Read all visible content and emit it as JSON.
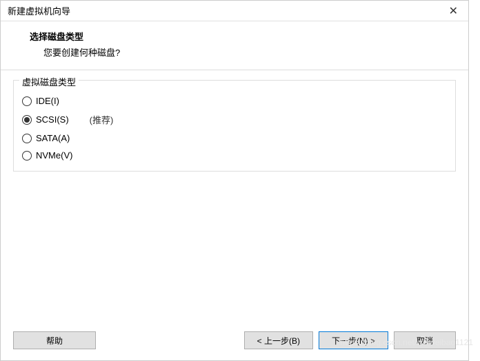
{
  "titlebar": {
    "title": "新建虚拟机向导"
  },
  "header": {
    "title": "选择磁盘类型",
    "subtitle": "您要创建何种磁盘?"
  },
  "group": {
    "legend": "虚拟磁盘类型",
    "options": [
      {
        "label": "IDE(I)",
        "hint": "",
        "selected": false
      },
      {
        "label": "SCSI(S)",
        "hint": "(推荐)",
        "selected": true
      },
      {
        "label": "SATA(A)",
        "hint": "",
        "selected": false
      },
      {
        "label": "NVMe(V)",
        "hint": "",
        "selected": false
      }
    ]
  },
  "buttons": {
    "help": "帮助",
    "back": "< 上一步(B)",
    "next": "下一步(N) >",
    "cancel": "取消"
  },
  "watermark": "https://blog.csdn.net/weiweibao1121"
}
